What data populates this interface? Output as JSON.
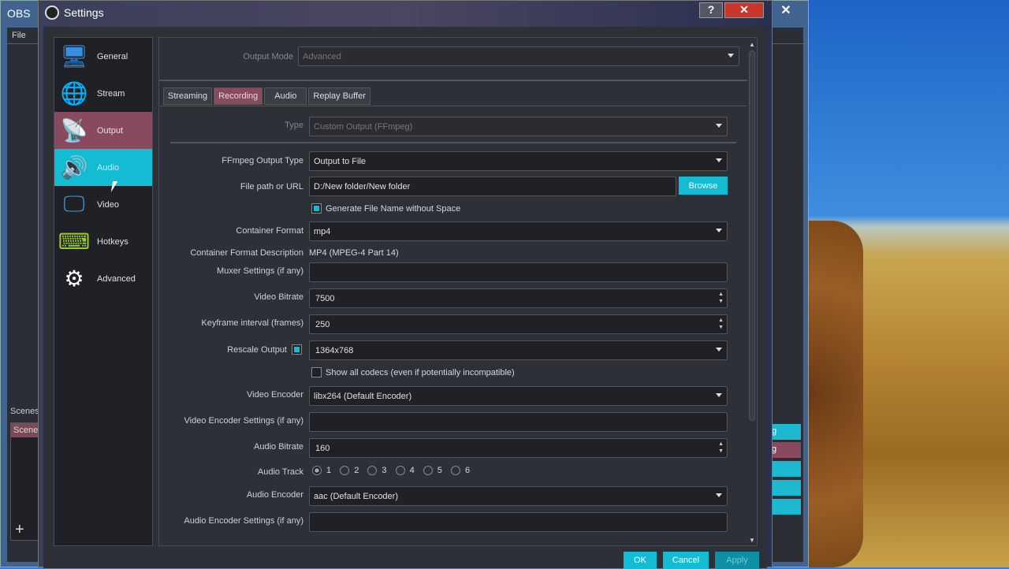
{
  "main_window": {
    "title": "OBS",
    "menu_file": "File",
    "scenes_label": "Scenes",
    "scene_item": "Scene",
    "add": "+",
    "close": "✕",
    "right_buttons": [
      "g",
      "g",
      "",
      "",
      ""
    ]
  },
  "dialog": {
    "title": "Settings",
    "help": "?",
    "close": "✕"
  },
  "sidebar": {
    "items": [
      {
        "label": "General",
        "icon": "general-icon"
      },
      {
        "label": "Stream",
        "icon": "globe-icon"
      },
      {
        "label": "Output",
        "icon": "broadcast-icon"
      },
      {
        "label": "Audio",
        "icon": "speaker-icon"
      },
      {
        "label": "Video",
        "icon": "monitor-icon"
      },
      {
        "label": "Hotkeys",
        "icon": "keyboard-icon"
      },
      {
        "label": "Advanced",
        "icon": "gears-icon"
      }
    ],
    "selected": "Output",
    "hovered": "Audio"
  },
  "output": {
    "mode_label": "Output Mode",
    "mode_value": "Advanced",
    "tabs": [
      "Streaming",
      "Recording",
      "Audio",
      "Replay Buffer"
    ],
    "active_tab": "Recording",
    "type_label": "Type",
    "type_value": "Custom Output (FFmpeg)",
    "ffmpeg_type_label": "FFmpeg Output Type",
    "ffmpeg_type_value": "Output to File",
    "path_label": "File path or URL",
    "path_value": "D:/New folder/New folder",
    "browse": "Browse",
    "gen_name_label": "Generate File Name without Space",
    "gen_name_checked": true,
    "container_label": "Container Format",
    "container_value": "mp4",
    "container_desc_label": "Container Format Description",
    "container_desc_value": "MP4 (MPEG-4 Part 14)",
    "muxer_label": "Muxer Settings (if any)",
    "muxer_value": "",
    "vbitrate_label": "Video Bitrate",
    "vbitrate_value": "7500",
    "keyframe_label": "Keyframe interval (frames)",
    "keyframe_value": "250",
    "rescale_label": "Rescale Output",
    "rescale_checked": true,
    "rescale_value": "1364x768",
    "show_codecs_label": "Show all codecs (even if potentially incompatible)",
    "show_codecs_checked": false,
    "vencoder_label": "Video Encoder",
    "vencoder_value": "libx264 (Default Encoder)",
    "venc_settings_label": "Video Encoder Settings (if any)",
    "venc_settings_value": "",
    "abitrate_label": "Audio Bitrate",
    "abitrate_value": "160",
    "atrack_label": "Audio Track",
    "atracks": [
      "1",
      "2",
      "3",
      "4",
      "5",
      "6"
    ],
    "atrack_selected": "1",
    "aencoder_label": "Audio Encoder",
    "aencoder_value": "aac (Default Encoder)",
    "aenc_settings_label": "Audio Encoder Settings (if any)",
    "aenc_settings_value": ""
  },
  "buttons": {
    "ok": "OK",
    "cancel": "Cancel",
    "apply": "Apply"
  },
  "colors": {
    "accent": "#13bcd2",
    "selected": "#8a4a5e",
    "background": "#2d3037"
  }
}
